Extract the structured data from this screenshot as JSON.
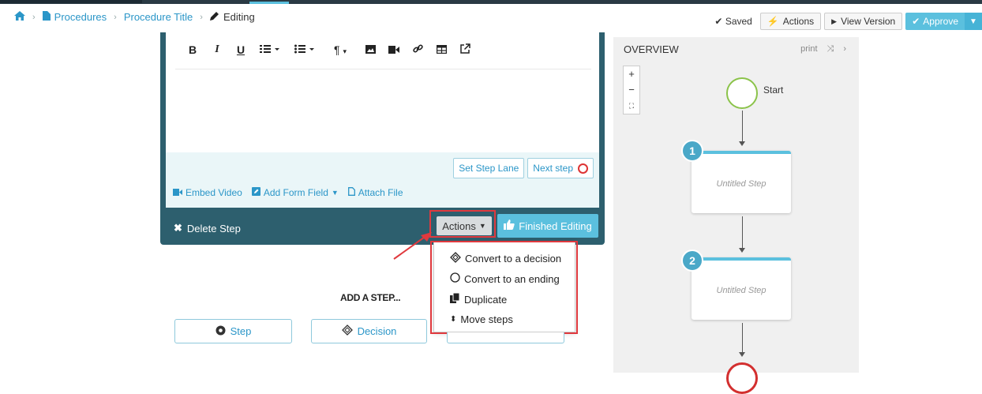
{
  "breadcrumb": {
    "items": [
      "Procedures",
      "Procedure Title"
    ],
    "current": "Editing"
  },
  "header": {
    "saved_label": "Saved",
    "actions_label": "Actions",
    "view_version_label": "View Version",
    "approve_label": "Approve"
  },
  "editor": {
    "toolbar": [
      "B",
      "I",
      "U"
    ],
    "set_step_lane_label": "Set Step Lane",
    "next_step_label": "Next step",
    "embed_video_label": "Embed Video",
    "add_form_field_label": "Add Form Field",
    "attach_file_label": "Attach File",
    "delete_step_label": "Delete Step",
    "actions_label": "Actions",
    "finished_editing_label": "Finished Editing"
  },
  "actions_menu": {
    "items": [
      "Convert to a decision",
      "Convert to an ending",
      "Duplicate",
      "Move steps"
    ]
  },
  "add_step": {
    "title": "ADD A STEP...",
    "step_label": "Step",
    "decision_label": "Decision"
  },
  "overview": {
    "title": "OVERVIEW",
    "print_label": "print",
    "zoom_in": "+",
    "zoom_out": "−",
    "start_label": "Start",
    "steps": [
      {
        "number": "1",
        "title": "Untitled Step"
      },
      {
        "number": "2",
        "title": "Untitled Step"
      }
    ]
  },
  "colors": {
    "accent": "#5bc0de",
    "link": "#2b96c8",
    "editor_footer": "#2d5f6e",
    "highlight": "#e0393e"
  }
}
